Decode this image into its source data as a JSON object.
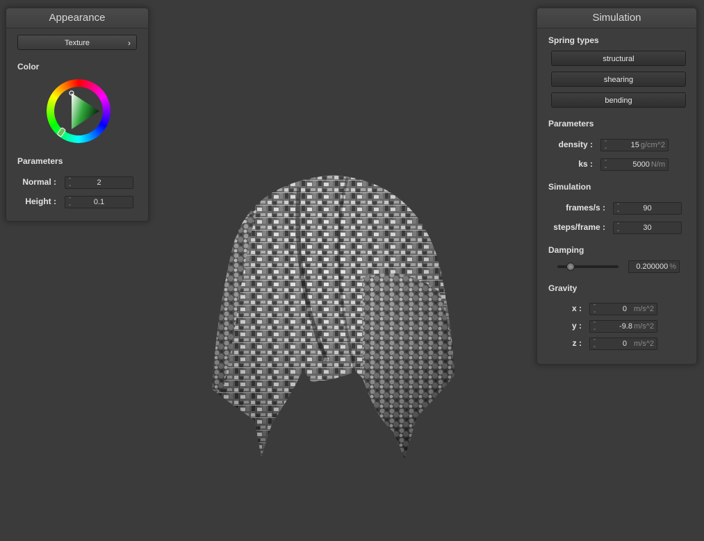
{
  "appearance": {
    "title": "Appearance",
    "texture_button": "Texture",
    "color_section": "Color",
    "parameters_section": "Parameters",
    "normal_label": "Normal :",
    "normal_value": "2",
    "height_label": "Height :",
    "height_value": "0.1",
    "selected_color": "#2fa83a"
  },
  "simulation": {
    "title": "Simulation",
    "spring_types_section": "Spring types",
    "spring_buttons": [
      "structural",
      "shearing",
      "bending"
    ],
    "parameters_section": "Parameters",
    "density_label": "density :",
    "density_value": "15",
    "density_unit": "g/cm^2",
    "ks_label": "ks :",
    "ks_value": "5000",
    "ks_unit": "N/m",
    "simulation_section": "Simulation",
    "fps_label": "frames/s :",
    "fps_value": "90",
    "steps_label": "steps/frame :",
    "steps_value": "30",
    "damping_section": "Damping",
    "damping_value": "0.200000",
    "damping_unit": "%",
    "damping_fraction": 0.2,
    "gravity_section": "Gravity",
    "gx_label": "x :",
    "gx_value": "0",
    "gy_label": "y :",
    "gy_value": "-9.8",
    "gz_label": "z :",
    "gz_value": "0",
    "gravity_unit": "m/s^2"
  },
  "viewport": {
    "object": "cloth draped over sphere with grayscale city texture",
    "background": "#3b3b3b"
  }
}
